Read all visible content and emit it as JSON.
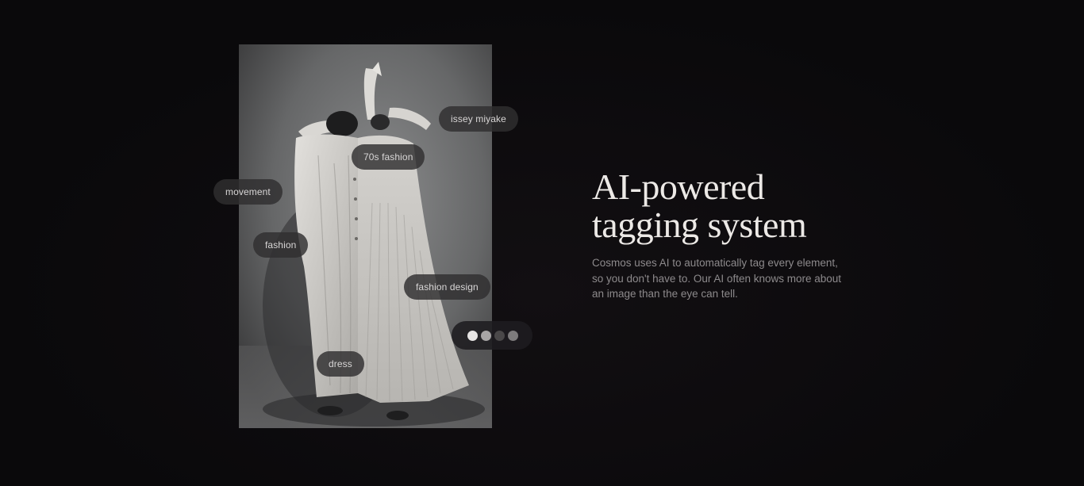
{
  "heading": {
    "line1": "AI-powered",
    "line2": "tagging system"
  },
  "description": "Cosmos uses AI to automatically tag every element, so you don't have to. Our AI often knows more about an image than the eye can tell.",
  "tags": {
    "issey_miyake": "issey miyake",
    "seventies_fashion": "70s fashion",
    "movement": "movement",
    "fashion": "fashion",
    "fashion_design": "fashion design",
    "dress": "dress"
  },
  "carousel": {
    "dot_colors": [
      "#e6e4e3",
      "#a8a6a6",
      "#4a4849",
      "#7d7b7c"
    ]
  },
  "colors": {
    "background": "#0b0a0c",
    "heading": "#ece9e6",
    "body_text": "#8d8a8c"
  }
}
